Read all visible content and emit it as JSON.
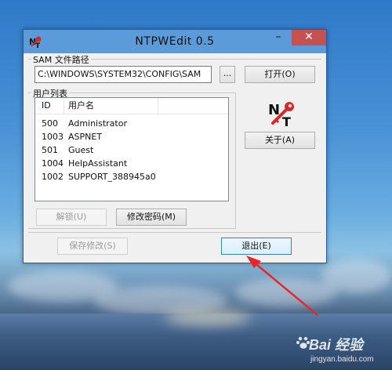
{
  "window": {
    "title": "NTPWEdit 0.5",
    "minimize_glyph": "–",
    "close_glyph": "✕"
  },
  "sam": {
    "group_label": "SAM 文件路径",
    "path_value": "C:\\WINDOWS\\SYSTEM32\\CONFIG\\SAM",
    "browse_label": "...",
    "open_label": "打开(O)"
  },
  "users": {
    "group_label": "用户列表",
    "columns": [
      "ID",
      "用户名"
    ],
    "rows": [
      {
        "id": "500",
        "name": "Administrator"
      },
      {
        "id": "1003",
        "name": "ASPNET"
      },
      {
        "id": "501",
        "name": "Guest"
      },
      {
        "id": "1004",
        "name": "HelpAssistant"
      },
      {
        "id": "1002",
        "name": "SUPPORT_388945a0"
      }
    ],
    "unlock_label": "解锁(U)",
    "change_password_label": "修改密码(M)"
  },
  "side": {
    "logo_icon": "ntpwedit-key-logo-icon",
    "about_label": "关于(A)"
  },
  "footer": {
    "save_label": "保存修改(S)",
    "exit_label": "退出(E)"
  },
  "annotation": {
    "arrow_color": "#e8262a"
  },
  "watermark": {
    "brand": "Bai 经验",
    "url": "jingyan.baidu.com"
  }
}
